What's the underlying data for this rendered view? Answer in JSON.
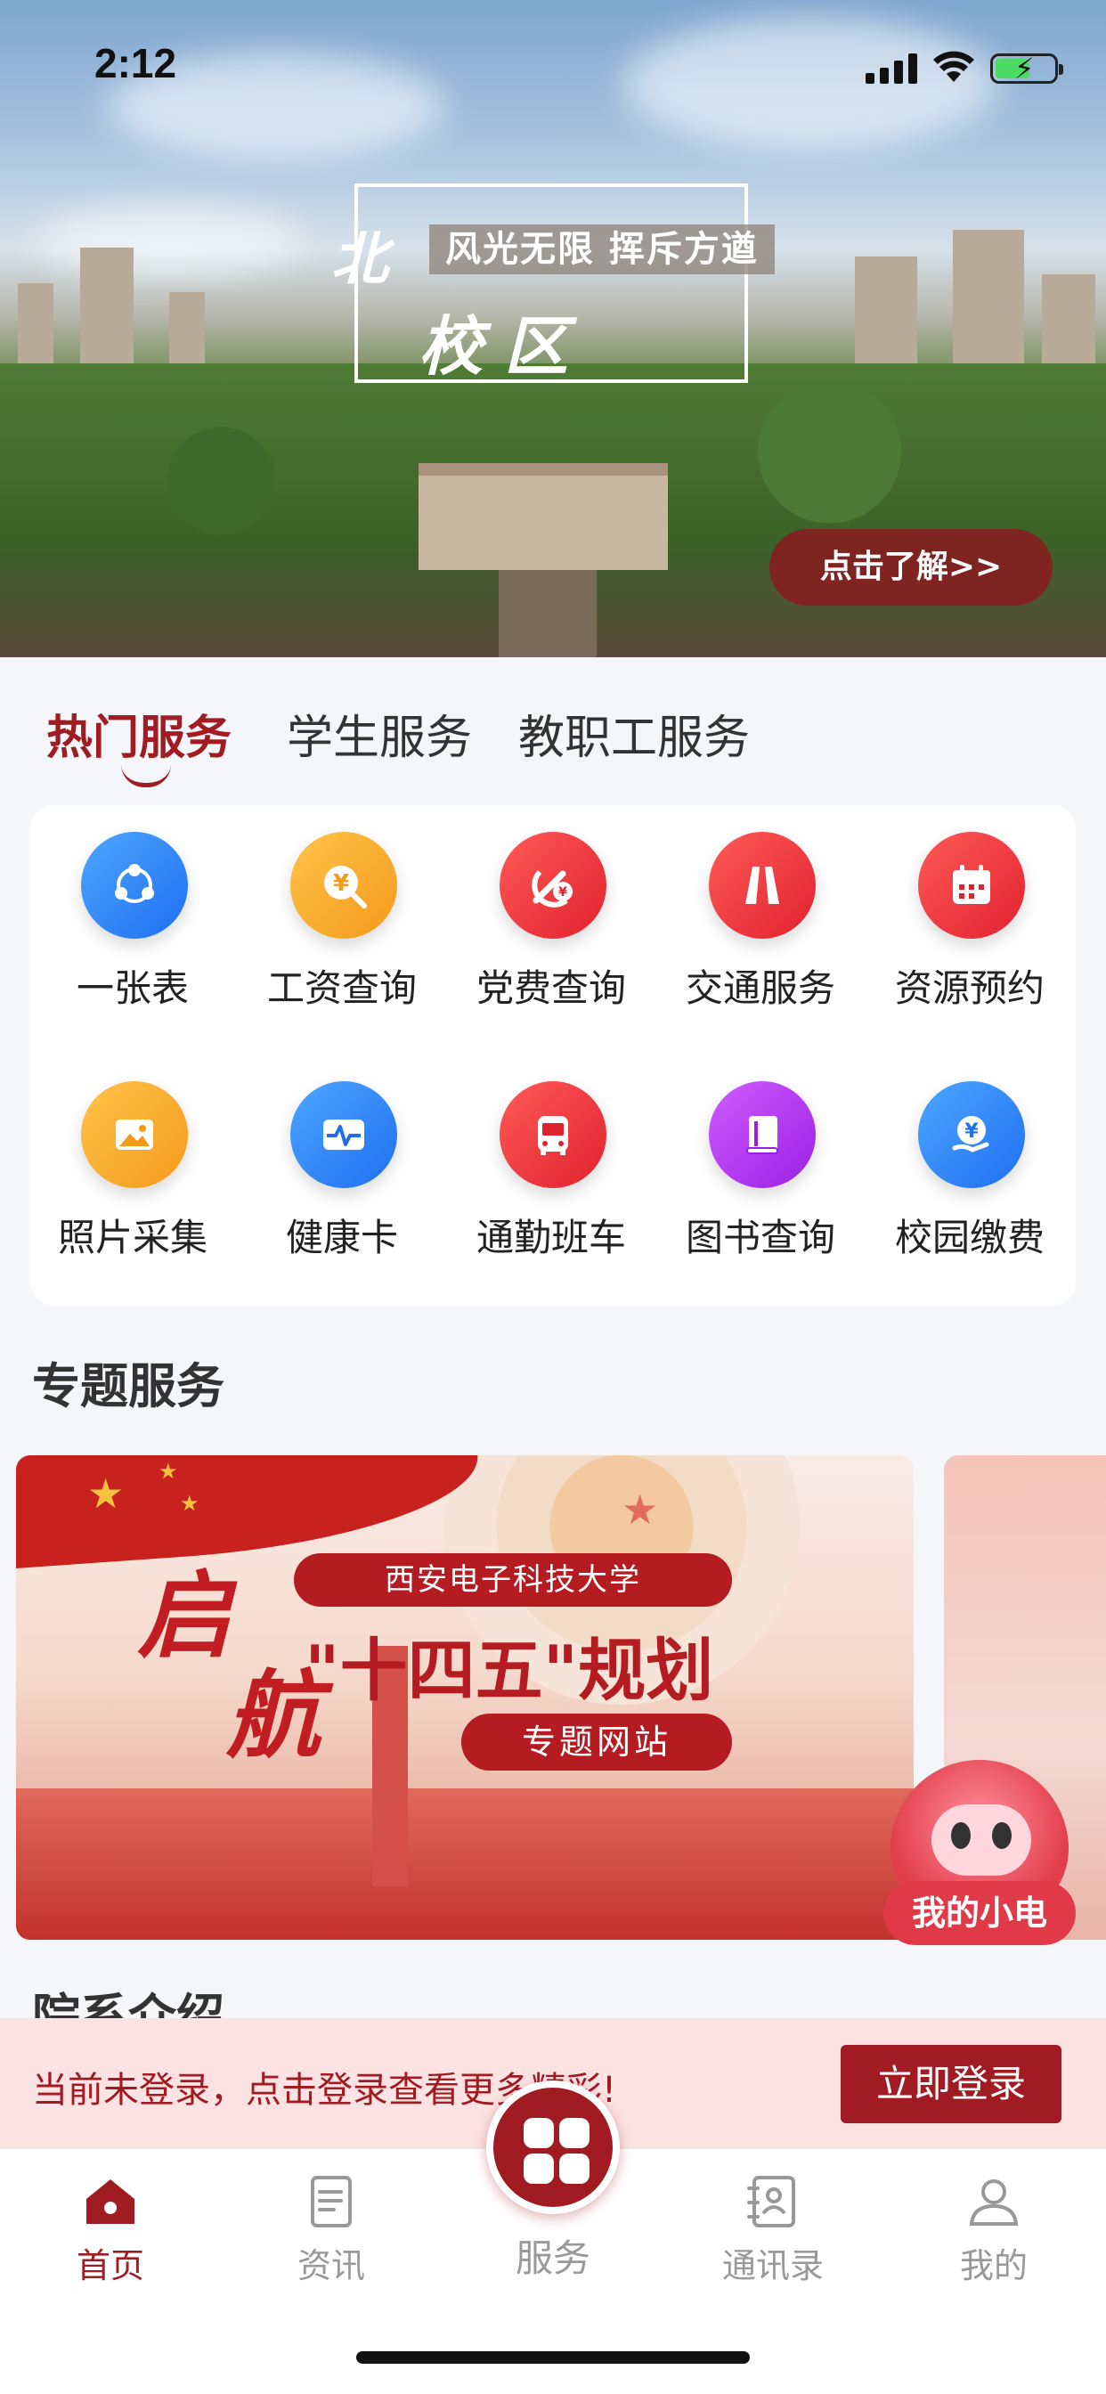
{
  "status_bar": {
    "time": "2:12"
  },
  "hero": {
    "title_part1": "北",
    "title_part2": "校区",
    "slogan": "风光无限 挥斥方遒",
    "button_label": "点击了解>>"
  },
  "service_tabs": [
    {
      "label": "热门服务",
      "active": true
    },
    {
      "label": "学生服务",
      "active": false
    },
    {
      "label": "教职工服务",
      "active": false
    }
  ],
  "services": [
    {
      "label": "一张表",
      "icon": "share-nodes-icon",
      "color": "blue"
    },
    {
      "label": "工资查询",
      "icon": "yuan-search-icon",
      "color": "orange"
    },
    {
      "label": "党费查询",
      "icon": "party-emblem-icon",
      "color": "red"
    },
    {
      "label": "交通服务",
      "icon": "road-icon",
      "color": "red"
    },
    {
      "label": "资源预约",
      "icon": "calendar-icon",
      "color": "red"
    },
    {
      "label": "照片采集",
      "icon": "image-icon",
      "color": "orange"
    },
    {
      "label": "健康卡",
      "icon": "health-pulse-icon",
      "color": "blue"
    },
    {
      "label": "通勤班车",
      "icon": "bus-icon",
      "color": "red"
    },
    {
      "label": "图书查询",
      "icon": "book-icon",
      "color": "purple"
    },
    {
      "label": "校园缴费",
      "icon": "yuan-hand-icon",
      "color": "blue"
    }
  ],
  "special_services": {
    "title": "专题服务",
    "banner": {
      "calligraphy_1": "启",
      "calligraphy_2": "航",
      "university": "西安电子科技大学",
      "headline": "\"十四五\"规划",
      "subtitle": "专题网站"
    }
  },
  "mascot": {
    "label": "我的小电"
  },
  "departments": {
    "title": "院系介绍"
  },
  "login_prompt": {
    "message": "当前未登录，点击登录查看更多精彩!",
    "button": "立即登录"
  },
  "bottom_nav": {
    "items": [
      {
        "label": "首页",
        "icon": "home-icon",
        "active": true
      },
      {
        "label": "资讯",
        "icon": "news-icon",
        "active": false
      },
      {
        "label": "服务",
        "icon": "grid-icon",
        "active": false
      },
      {
        "label": "通讯录",
        "icon": "contacts-icon",
        "active": false
      },
      {
        "label": "我的",
        "icon": "profile-icon",
        "active": false
      }
    ]
  },
  "colors": {
    "brand": "#a01b22",
    "login_bg": "#fbe3e4",
    "page_bg": "#f5f6fa"
  }
}
